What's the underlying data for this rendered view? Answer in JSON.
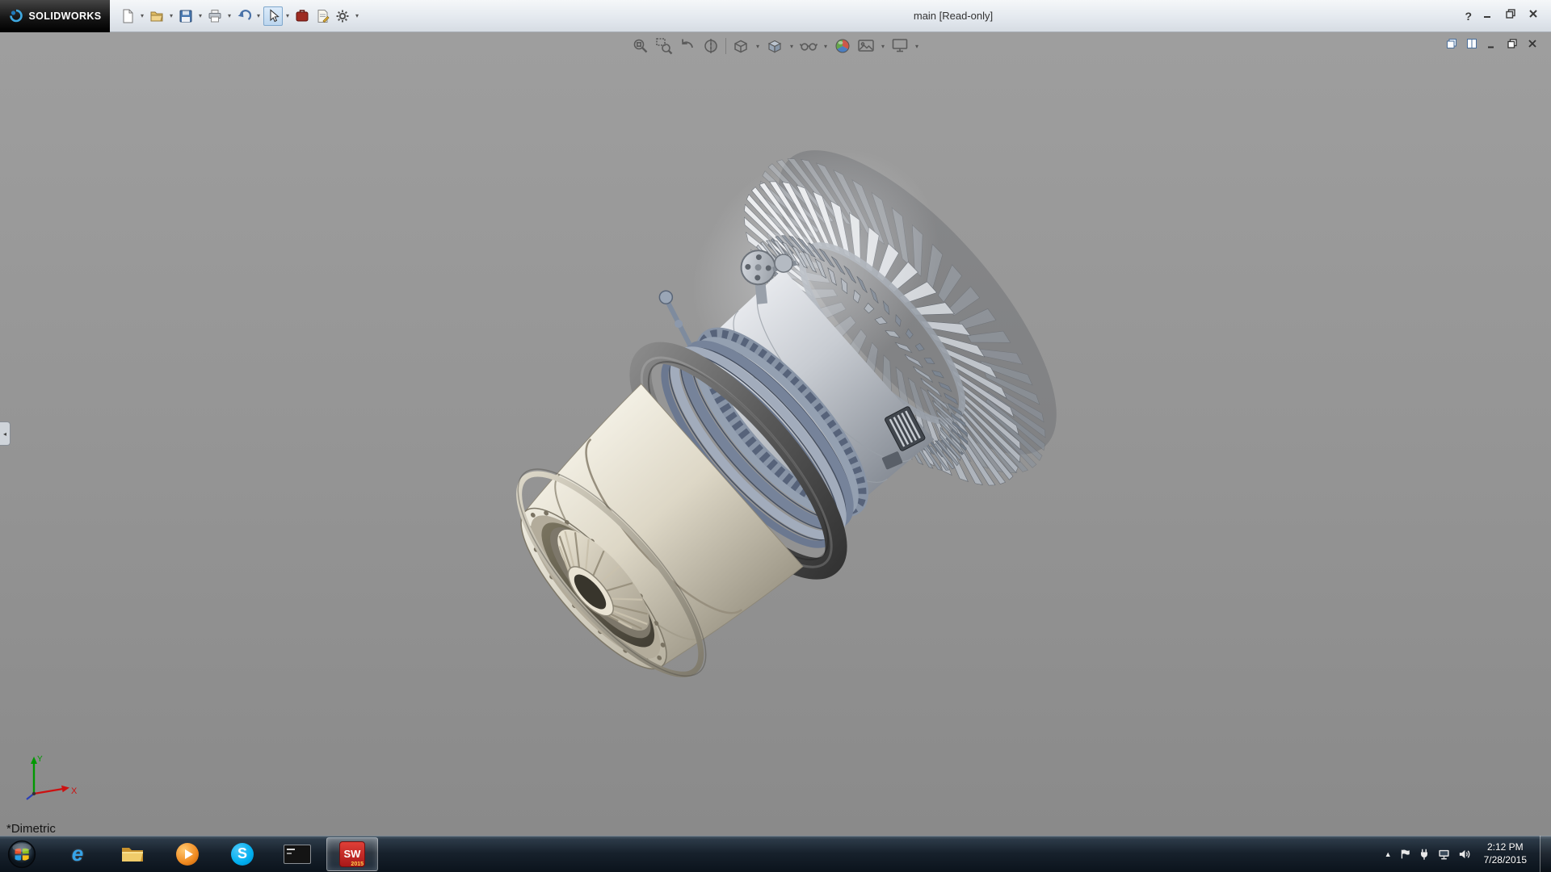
{
  "titlebar": {
    "brand": "SOLIDWORKS",
    "title": "main [Read-only]",
    "help_glyph": "?"
  },
  "ui": {
    "dropdown_glyph": "▾",
    "overflow_glyph": "▲",
    "panel_tab_glyph": "◂"
  },
  "main_toolbar": {
    "items": [
      "new",
      "open",
      "save",
      "print",
      "undo",
      "select",
      "toolbox",
      "file-properties",
      "options"
    ]
  },
  "headsup_toolbar": {
    "items": [
      "zoom-to-fit",
      "zoom-to-area",
      "previous-view",
      "section-view",
      "view-orientation",
      "display-style",
      "hide-show-items",
      "edit-appearance",
      "apply-scene",
      "view-settings"
    ]
  },
  "document_controls": [
    "cascade",
    "tile",
    "minimize",
    "restore",
    "close"
  ],
  "viewport": {
    "view_label": "*Dimetric",
    "triad": {
      "x_label": "X",
      "y_label": "Y"
    }
  },
  "taskbar": {
    "items": [
      {
        "name": "start"
      },
      {
        "name": "internet-explorer",
        "glyph": "e"
      },
      {
        "name": "file-explorer"
      },
      {
        "name": "media-player"
      },
      {
        "name": "skype",
        "glyph": "S"
      },
      {
        "name": "command-prompt"
      },
      {
        "name": "solidworks",
        "glyph": "SW",
        "badge": "2015",
        "active": true
      }
    ],
    "tray": {
      "time": "2:12 PM",
      "date": "7/28/2015"
    }
  },
  "colors": {
    "sw_red": "#c01f1f",
    "steel_blue": "#8b97a8",
    "engine_cream": "#e7e2d2",
    "engine_dark_ring": "#4f4f4f",
    "viewport_gray": "#949494",
    "taskbar_glass": "#17212c",
    "skype_blue": "#00aff0",
    "ie_blue": "#35a3e8",
    "media_orange": "#f08a20",
    "folder_gold": "#e8c560"
  }
}
